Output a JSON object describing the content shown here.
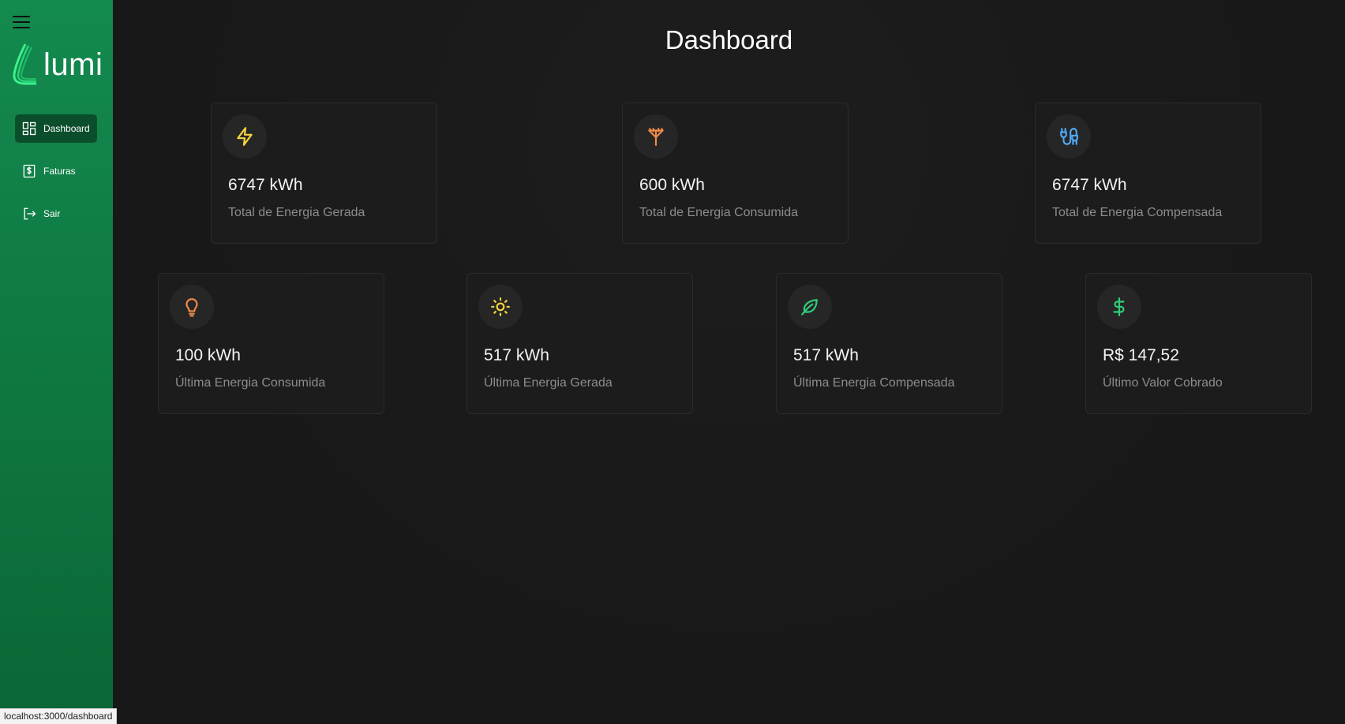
{
  "sidebar": {
    "logo_text": "lumi",
    "items": [
      {
        "label": "Dashboard",
        "icon": "dashboard-icon",
        "active": true
      },
      {
        "label": "Faturas",
        "icon": "invoice-icon",
        "active": false
      },
      {
        "label": "Sair",
        "icon": "logout-icon",
        "active": false
      }
    ]
  },
  "main": {
    "title": "Dashboard",
    "cards": [
      {
        "value": "6747 kWh",
        "label": "Total de Energia Gerada",
        "icon": "lightning-icon",
        "color": "#f5d53d"
      },
      {
        "value": "600 kWh",
        "label": "Total de Energia Consumida",
        "icon": "power-pole-icon",
        "color": "#f08b4a"
      },
      {
        "value": "6747 kWh",
        "label": "Total de Energia Compensada",
        "icon": "plug-cable-icon",
        "color": "#4fa9f5"
      },
      {
        "value": "100 kWh",
        "label": "Última Energia Consumida",
        "icon": "lightbulb-icon",
        "color": "#f08b4a"
      },
      {
        "value": "517 kWh",
        "label": "Última Energia Gerada",
        "icon": "sun-icon",
        "color": "#f5d53d"
      },
      {
        "value": "517 kWh",
        "label": "Última Energia Compensada",
        "icon": "leaf-icon",
        "color": "#2fcf7a"
      },
      {
        "value": "R$ 147,52",
        "label": "Último Valor Cobrado",
        "icon": "dollar-icon",
        "color": "#2fcf7a"
      }
    ]
  },
  "status_bar": {
    "url": "localhost:3000/dashboard"
  },
  "colors": {
    "sidebar": "#138a4f",
    "background": "#181818",
    "card": "#1c1c1c"
  }
}
